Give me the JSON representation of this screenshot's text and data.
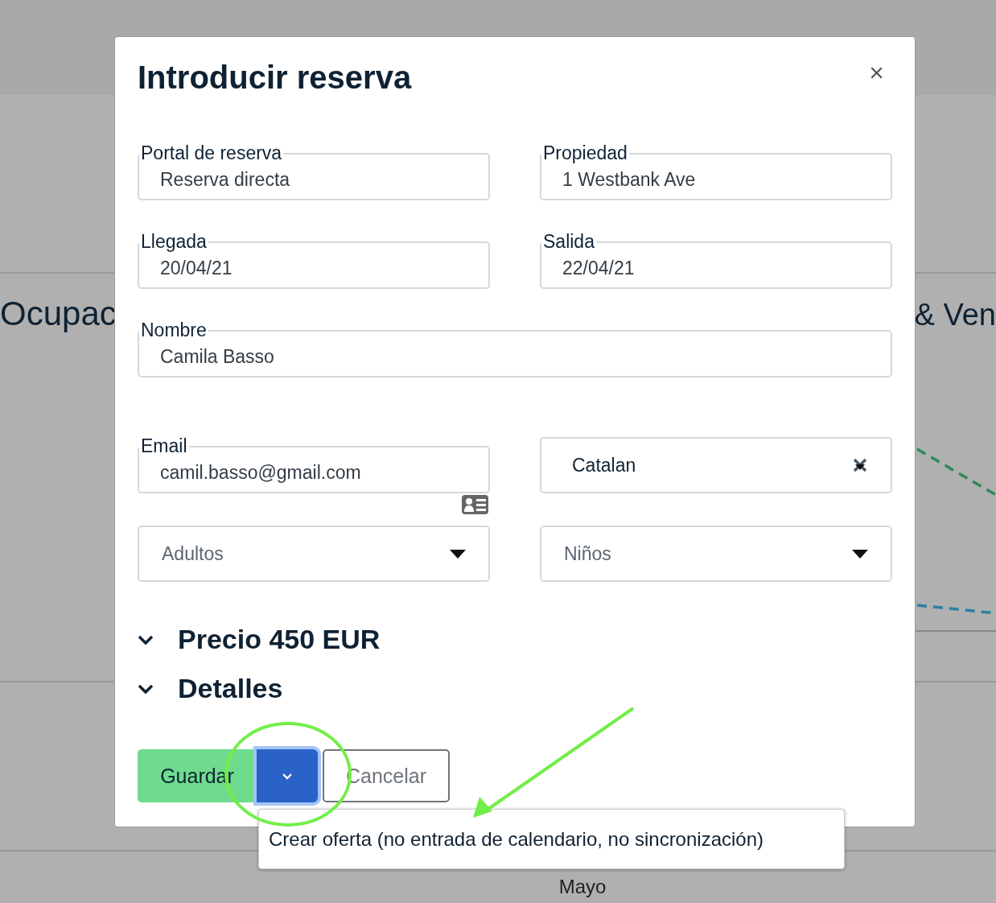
{
  "background": {
    "heading_left": "Ocupac",
    "heading_right": "& Ven",
    "axis_label": "Mayo"
  },
  "dialog": {
    "title": "Introducir reserva",
    "close": "×",
    "rows": [
      {
        "fields": [
          {
            "kind": "text",
            "label": "Portal de reserva",
            "value": "Reserva directa"
          },
          {
            "kind": "text",
            "label": "Propiedad",
            "value": "1 Westbank Ave"
          }
        ]
      },
      {
        "fields": [
          {
            "kind": "text",
            "label": "Llegada",
            "value": "20/04/21"
          },
          {
            "kind": "text",
            "label": "Salida",
            "value": "22/04/21"
          }
        ]
      },
      {
        "fields": [
          {
            "kind": "text",
            "label": "Nombre",
            "value": "Camila Basso"
          }
        ]
      },
      {
        "fields": [
          {
            "kind": "email",
            "label": "Email",
            "value": "camil.basso@gmail.com"
          },
          {
            "kind": "select",
            "value": "Catalan"
          }
        ]
      },
      {
        "fields": [
          {
            "kind": "dropdown",
            "placeholder": "Adultos"
          },
          {
            "kind": "dropdown",
            "placeholder": "Niños"
          }
        ]
      }
    ],
    "sections": [
      {
        "title": "Precio 450 EUR"
      },
      {
        "title": "Detalles"
      }
    ],
    "buttons": {
      "save": "Guardar",
      "cancel": "Cancelar"
    },
    "menu": {
      "item": "Crear oferta (no entrada de calendario, no sincronización)"
    }
  }
}
